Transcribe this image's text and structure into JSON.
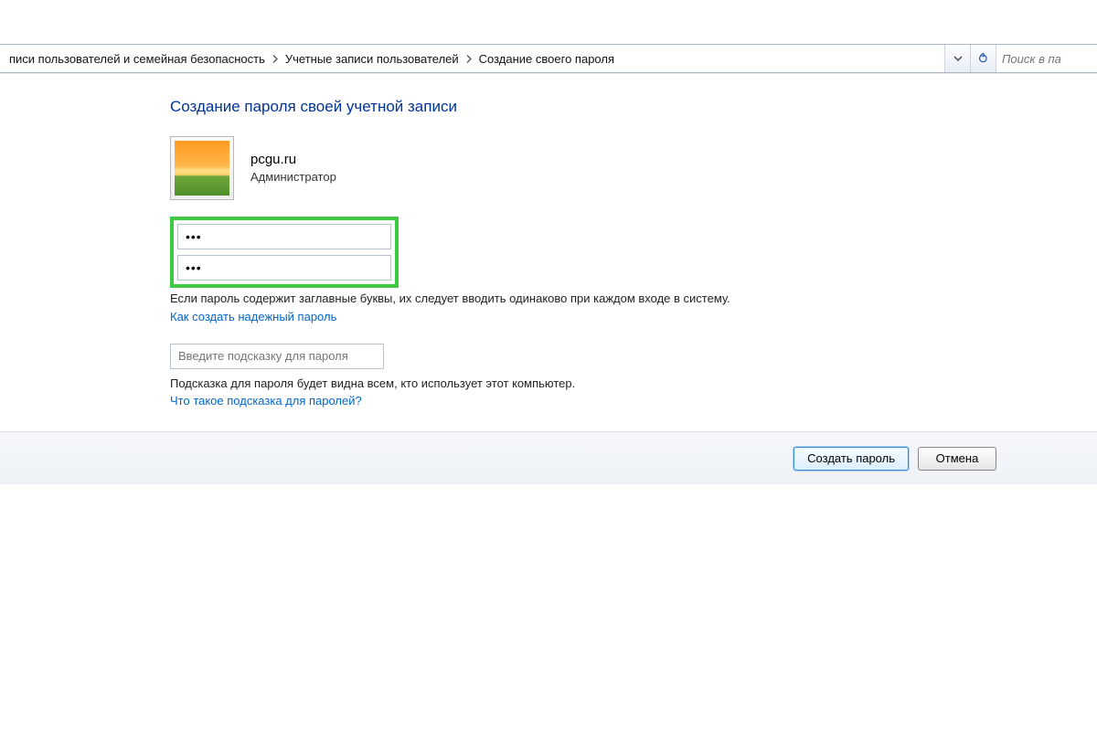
{
  "breadcrumb": {
    "item0": "писи пользователей и семейная безопасность",
    "item1": "Учетные записи пользователей",
    "item2": "Создание своего пароля"
  },
  "search": {
    "placeholder": "Поиск в па"
  },
  "page": {
    "title": "Создание пароля своей учетной записи"
  },
  "user": {
    "name": "pcgu.ru",
    "role": "Администратор"
  },
  "password": {
    "value1": "•••",
    "value2": "•••"
  },
  "caps_note": "Если пароль содержит заглавные буквы, их следует вводить одинаково при каждом входе в систему.",
  "link_strong_pwd": "Как создать надежный пароль",
  "hint": {
    "placeholder": "Введите подсказку для пароля",
    "visibility_note": "Подсказка для пароля будет видна всем, кто использует этот компьютер.",
    "what_is_link": "Что такое подсказка для паролей?"
  },
  "buttons": {
    "create": "Создать пароль",
    "cancel": "Отмена"
  }
}
